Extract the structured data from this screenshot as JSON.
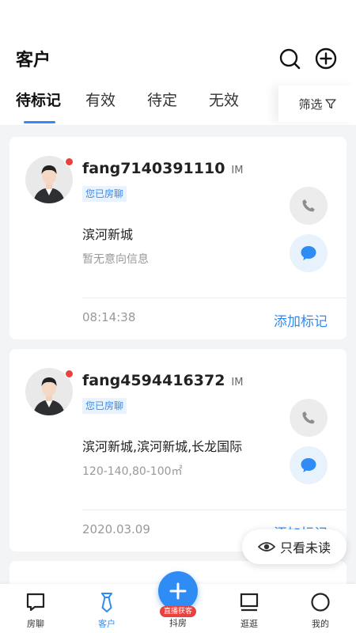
{
  "header": {
    "title": "客户",
    "tabs": [
      "待标记",
      "有效",
      "待定",
      "无效"
    ],
    "filter_label": "筛选"
  },
  "cards": [
    {
      "name": "fang7140391110",
      "tag": "IM",
      "badge": "您已房聊",
      "area": "滨河新城",
      "intent": "暂无意向信息",
      "time": "08:14:38",
      "action": "添加标记"
    },
    {
      "name": "fang4594416372",
      "tag": "IM",
      "badge": "您已房聊",
      "area": "滨河新城,滨河新城,长龙国际",
      "intent": "120-140,80-100㎡",
      "time": "2020.03.09",
      "action": "添加标记"
    }
  ],
  "unread_toggle": "只看未读",
  "tabbar": {
    "items": [
      "房聊",
      "客户",
      "抖房",
      "逛逛",
      "我的"
    ],
    "fab_badge": "直播获客"
  },
  "colors": {
    "accent": "#2f8cf4",
    "badge_red": "#e8413e"
  }
}
